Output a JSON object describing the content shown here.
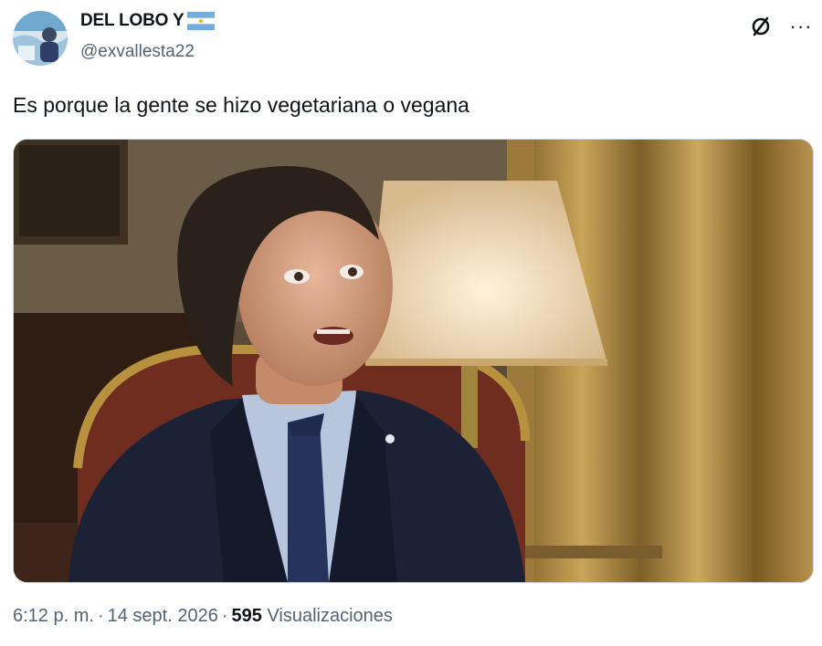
{
  "author": {
    "display_name": "DEL LOBO Y",
    "handle": "@exvallesta22",
    "flag_icon": "argentina-flag-icon",
    "avatar_icon": "avatar"
  },
  "header_actions": {
    "grok_icon": "grok-icon",
    "more_icon": "more-icon",
    "more_label": "···"
  },
  "tweet": {
    "text": "Es porque la gente se hizo vegetariana o vegana"
  },
  "media": {
    "type": "video-thumbnail"
  },
  "meta": {
    "time": "6:12 p. m.",
    "date": "14 sept. 2026",
    "separator": "·",
    "views_count": "595",
    "views_label": "Visualizaciones"
  },
  "colors": {
    "text_primary": "#0f1419",
    "text_secondary": "#536471",
    "border": "#cfd9de"
  }
}
